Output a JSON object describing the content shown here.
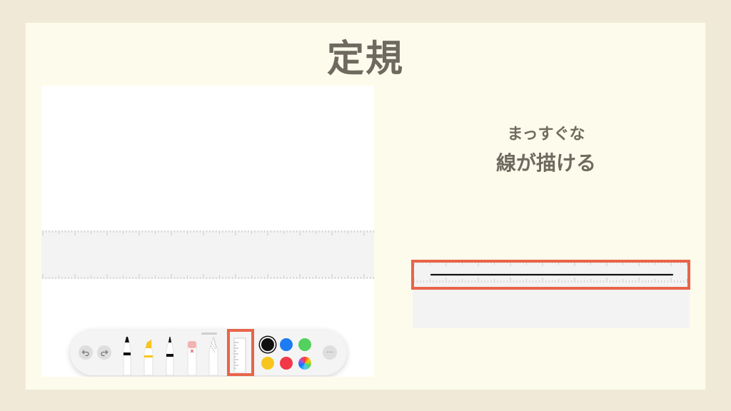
{
  "slide": {
    "title": "定規",
    "caption_line1": "まっすぐな",
    "caption_line2": "線が描ける"
  },
  "toolbar": {
    "undo_icon": "undo-arrow",
    "redo_icon": "redo-arrow",
    "tools": [
      "pen",
      "highlighter",
      "fineliner",
      "eraser",
      "lasso",
      "ruler"
    ],
    "selected_tool": "ruler",
    "more_label": "···"
  },
  "palette": {
    "colors": [
      "#111111",
      "#1e7cf2",
      "#52d15f",
      "#f8c51d",
      "#f13748",
      "rainbow"
    ],
    "selected": "#111111"
  },
  "accent": "#e8644a",
  "background": "#f1e9d8",
  "card_background": "#fdfcec"
}
